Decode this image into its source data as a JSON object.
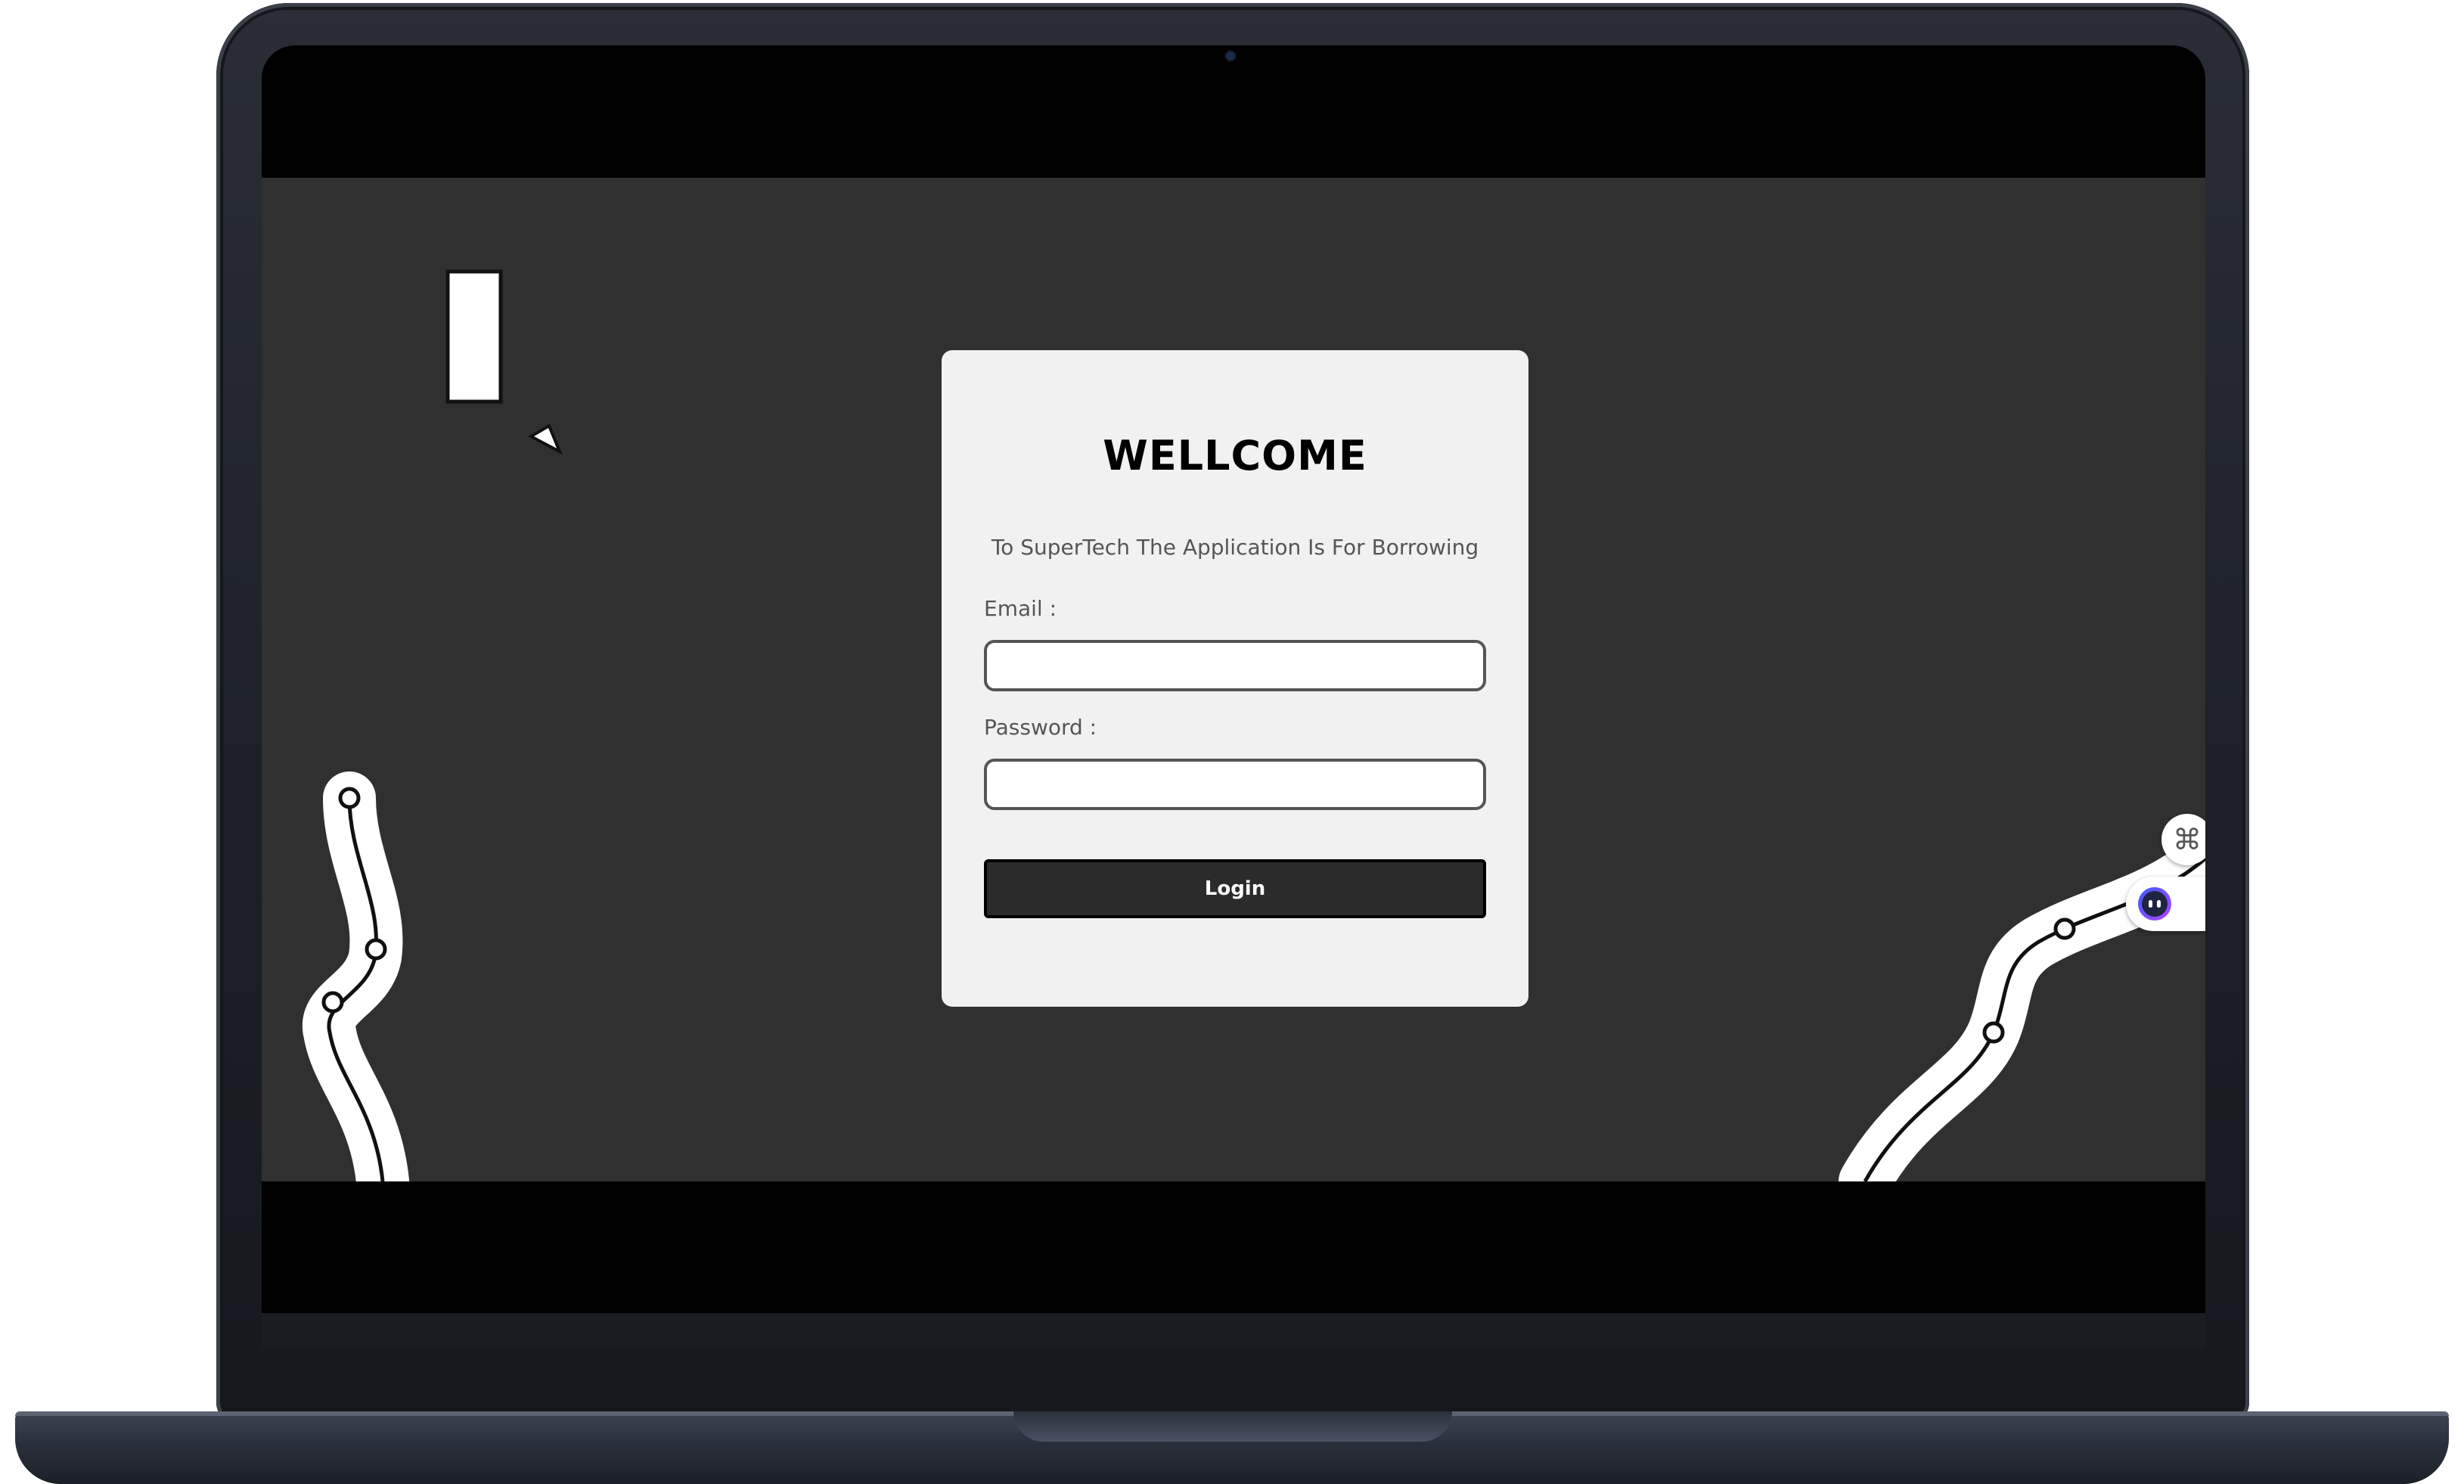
{
  "login": {
    "title": "WELLCOME",
    "subtitle": "To SuperTech The Application Is For Borrowing",
    "email_label": "Email :",
    "email_value": "",
    "password_label": "Password :",
    "password_value": "",
    "login_label": "Login"
  },
  "widgets": {
    "command_glyph": "⌘",
    "command_icon": "command-icon",
    "assistant_icon": "assistant-face-icon"
  },
  "colors": {
    "app_background": "#303030",
    "card_background": "#f1f1f1",
    "button_background": "#2b2b2b",
    "assistant_gradient_start": "#3b5bff",
    "assistant_gradient_end": "#b044ff"
  }
}
